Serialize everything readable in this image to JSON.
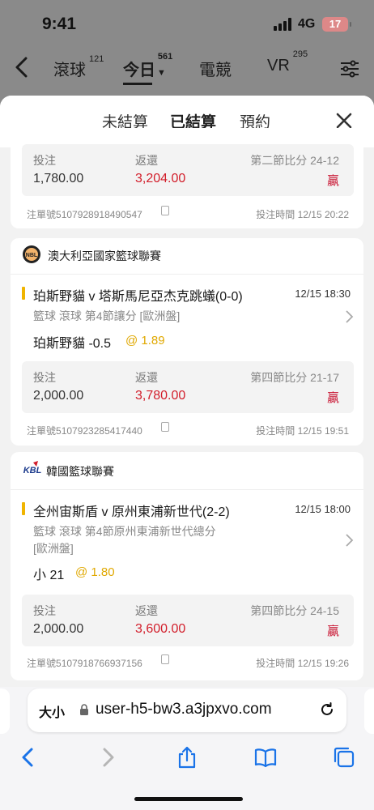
{
  "status": {
    "time": "9:41",
    "network": "4G",
    "battery": "17"
  },
  "sport_tabs": [
    {
      "label": "滾球",
      "count": "121"
    },
    {
      "label": "今日",
      "count": "561"
    },
    {
      "label": "電競",
      "count": ""
    },
    {
      "label": "VR",
      "count": "295"
    }
  ],
  "sheet_tabs": [
    "未結算",
    "已結算",
    "預約"
  ],
  "labels": {
    "stake": "投注",
    "return": "返還",
    "order_prefix": "注單號",
    "bet_time_prefix": "投注時間",
    "win": "贏"
  },
  "bets": [
    {
      "stake": "1,780.00",
      "return": "3,204.00",
      "score": "第二節比分 24-12",
      "order_no": "5107928918490547",
      "bet_time": "12/15 20:22"
    },
    {
      "league": "澳大利亞國家籃球聯賽",
      "logo": "NBL",
      "match": "珀斯野貓 v 塔斯馬尼亞杰克跳蟻(0-0)",
      "match_time": "12/15 18:30",
      "market": "籃球 滾球   第4節讓分 [歐洲盤]",
      "pick": "珀斯野貓 -0.5",
      "odds": "@ 1.89",
      "stake": "2,000.00",
      "return": "3,780.00",
      "score": "第四節比分 21-17",
      "order_no": "5107923285417440",
      "bet_time": "12/15 19:51"
    },
    {
      "league": "韓國籃球聯賽",
      "logo": "KBL",
      "match": "全州宙斯盾 v 原州東浦新世代(2-2)",
      "match_time": "12/15 18:00",
      "market_line1": "籃球 滾球   第4節原州東浦新世代總分",
      "market_line2": "[歐洲盤]",
      "pick": "小 21",
      "odds": "@ 1.80",
      "stake": "2,000.00",
      "return": "3,600.00",
      "score": "第四節比分 24-15",
      "order_no": "5107918766937156",
      "bet_time": "12/15 19:26"
    }
  ],
  "browser": {
    "text_size": "大小",
    "url": "user-h5-bw3.a3jpxvo.com"
  },
  "colors": {
    "accent": "#e3a23b",
    "return_red": "#d21d2a",
    "odds_yellow": "#e0a800",
    "ios_blue": "#1a73e8"
  }
}
